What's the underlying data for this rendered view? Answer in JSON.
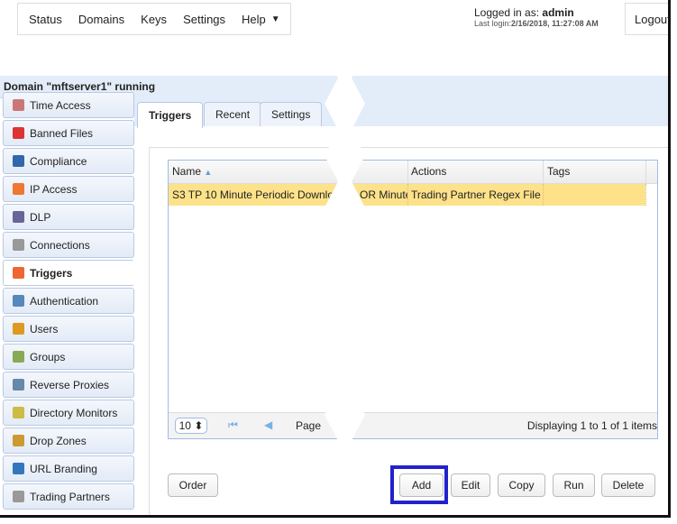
{
  "nav": [
    "Status",
    "Domains",
    "Keys",
    "Settings",
    "Help"
  ],
  "login": {
    "label": "Logged in as: ",
    "user": "admin",
    "last_label": "Last login:",
    "last_value": "2/16/2018, 11:27:08 AM",
    "logout": "Logout"
  },
  "domain_status": "Domain \"mftserver1\" running",
  "sidebar": [
    {
      "label": "Time Access",
      "color": "#c77"
    },
    {
      "label": "Banned Files",
      "color": "#d33"
    },
    {
      "label": "Compliance",
      "color": "#36a"
    },
    {
      "label": "IP Access",
      "color": "#e73"
    },
    {
      "label": "DLP",
      "color": "#669"
    },
    {
      "label": "Connections",
      "color": "#999"
    },
    {
      "label": "Triggers",
      "color": "#e63"
    },
    {
      "label": "Authentication",
      "color": "#58b"
    },
    {
      "label": "Users",
      "color": "#d92"
    },
    {
      "label": "Groups",
      "color": "#8a5"
    },
    {
      "label": "Reverse Proxies",
      "color": "#68a"
    },
    {
      "label": "Directory Monitors",
      "color": "#cb4"
    },
    {
      "label": "Drop Zones",
      "color": "#c93"
    },
    {
      "label": "URL Branding",
      "color": "#37b"
    },
    {
      "label": "Trading Partners",
      "color": "#999"
    }
  ],
  "active_sidebar": "Triggers",
  "tabs": [
    "Triggers",
    "Recent",
    "Settings"
  ],
  "grid": {
    "columns": [
      "Name",
      "Actions",
      "Tags"
    ],
    "rows": [
      {
        "name": "S3 TP 10 Minute Periodic Downlo",
        "name_tail": "OR Minute",
        "actions": "Trading Partner Regex File",
        "tags": ""
      }
    ],
    "page_size": "10",
    "page_label": "Page",
    "display": "Displaying 1 to 1 of 1 items"
  },
  "buttons": {
    "order": "Order",
    "add": "Add",
    "edit": "Edit",
    "copy": "Copy",
    "run": "Run",
    "delete": "Delete"
  },
  "highlight_color": "#2222cc"
}
